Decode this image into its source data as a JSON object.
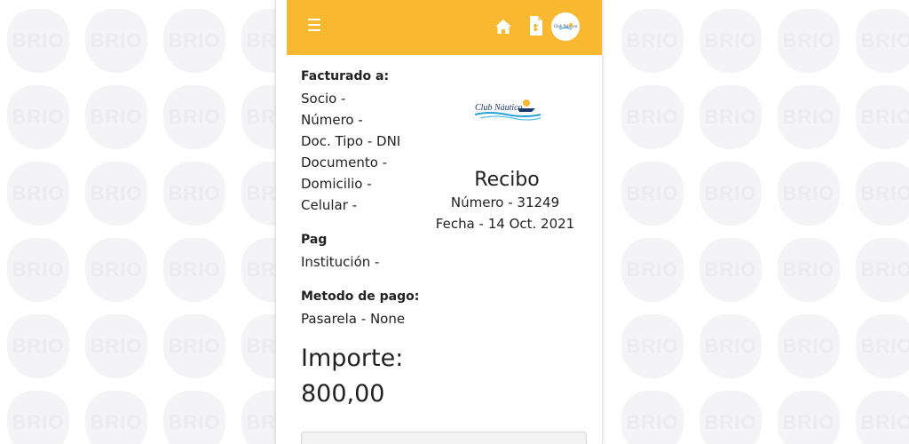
{
  "header": {
    "menu_icon": "hamburger-menu-icon",
    "home_icon": "home-icon",
    "document_icon": "document-icon",
    "avatar_text": "Club Náutico"
  },
  "billing": {
    "heading": "Facturado a:",
    "socio": "Socio -",
    "numero": "Número -",
    "doc_tipo": "Doc. Tipo - DNI",
    "documento": "Documento -",
    "domicilio": "Domicilio -",
    "celular": "Celular -"
  },
  "pag": {
    "heading": "Pag",
    "institucion": "Institución -"
  },
  "payment_method": {
    "heading": "Metodo de pago:",
    "pasarela": "Pasarela - None"
  },
  "receipt": {
    "logo_text": "Club Náutico",
    "title": "Recibo",
    "number": "Número - 31249",
    "date": "Fecha - 14 Oct. 2021"
  },
  "amount": {
    "label": "Importe:",
    "value": "800,00"
  },
  "watermark": {
    "text": "BRIO"
  },
  "colors": {
    "topbar": "#f8b931",
    "text": "#222222"
  }
}
